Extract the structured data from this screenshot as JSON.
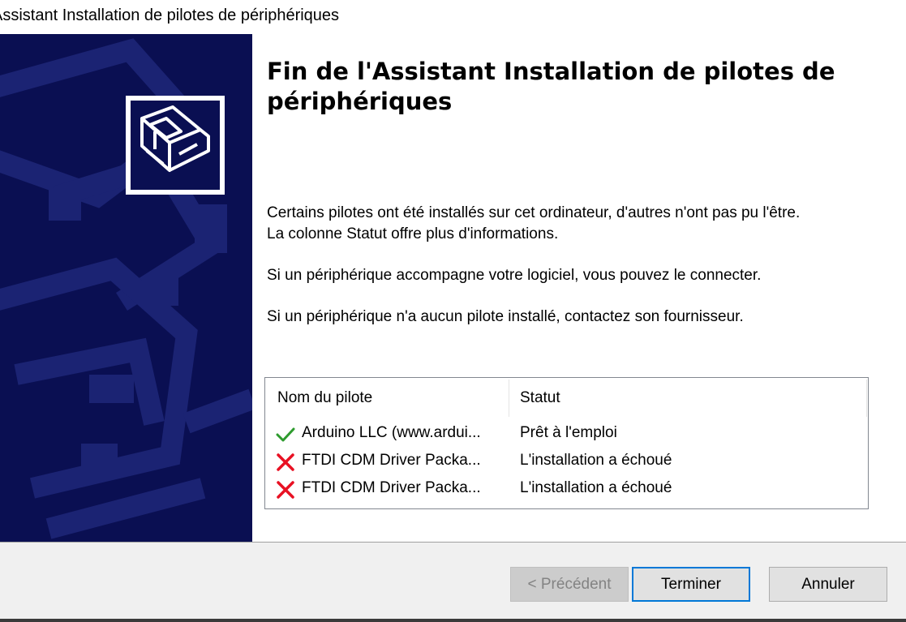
{
  "window": {
    "title": "Assistant Installation de pilotes de périphériques"
  },
  "main": {
    "heading": "Fin de l'Assistant Installation de pilotes de périphériques",
    "paragraph1_line1": "Certains pilotes ont été installés sur cet ordinateur, d'autres n'ont pas pu l'être.",
    "paragraph1_line2": "La colonne Statut offre plus d'informations.",
    "paragraph2": "Si un périphérique accompagne votre logiciel, vous pouvez le connecter.",
    "paragraph3": "Si un périphérique n'a aucun pilote installé, contactez son fournisseur."
  },
  "driver_list": {
    "columns": [
      "Nom du pilote",
      "Statut"
    ],
    "rows": [
      {
        "icon": "check-icon",
        "name": "Arduino LLC (www.ardui...",
        "status": "Prêt à l'emploi"
      },
      {
        "icon": "error-x-icon",
        "name": "FTDI CDM Driver Packa...",
        "status": "L'installation a échoué"
      },
      {
        "icon": "error-x-icon",
        "name": "FTDI CDM Driver Packa...",
        "status": "L'installation a échoué"
      }
    ]
  },
  "buttons": {
    "previous": "< Précédent",
    "finish": "Terminer",
    "cancel": "Annuler"
  },
  "colors": {
    "side_panel": "#0a0f52",
    "check": "#2e9b2e",
    "error": "#e81123",
    "focus_border": "#0078d7"
  }
}
